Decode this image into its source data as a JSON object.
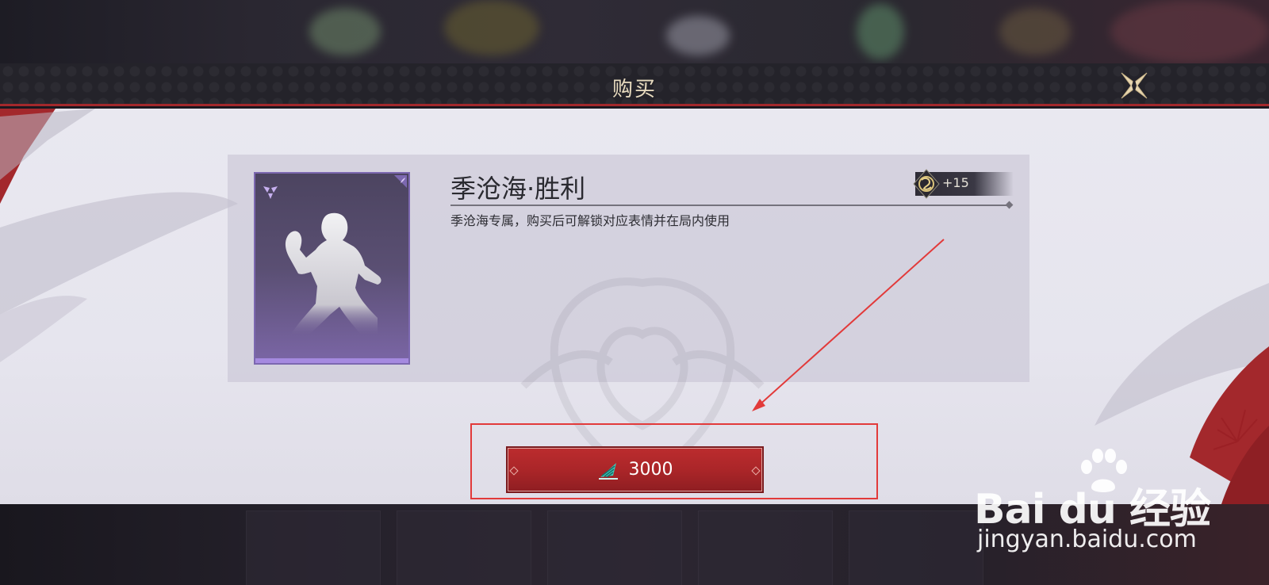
{
  "dialog": {
    "title": "购买",
    "close_icon": "close-x-icon"
  },
  "item": {
    "name": "季沧海·胜利",
    "description": "季沧海专属，购买后可解锁对应表情并在局内使用",
    "icon": "emote-pose-icon",
    "rarity_icon": "rarity-emblem-icon",
    "rarity_color": "#8a6fd0",
    "bonus": {
      "icon": "dragon-emblem-icon",
      "value": "+15"
    }
  },
  "purchase": {
    "currency_icon": "currency-drill-icon",
    "price": "3000",
    "button_color": "#b0282b"
  },
  "annotation": {
    "highlight_color": "#e23a3a"
  },
  "watermark": {
    "logo": "Bai du 经验",
    "url": "jingyan.baidu.com"
  }
}
